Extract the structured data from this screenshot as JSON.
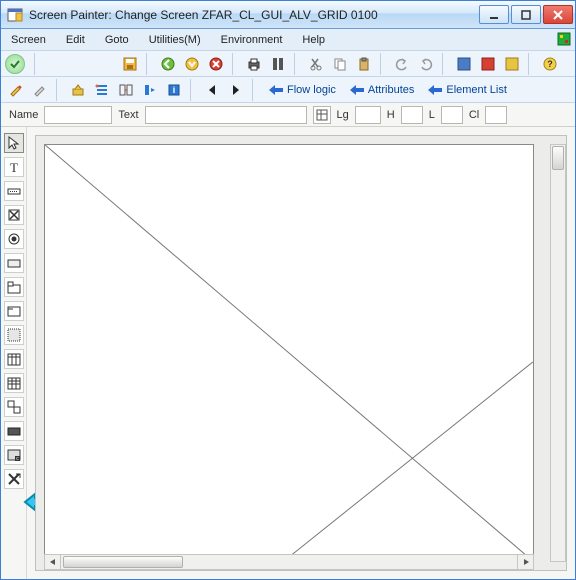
{
  "window": {
    "title": "Screen Painter:  Change Screen ZFAR_CL_GUI_ALV_GRID 0100"
  },
  "menu": {
    "screen": "Screen",
    "edit": "Edit",
    "goto": "Goto",
    "utilities": "Utilities(M)",
    "environment": "Environment",
    "help": "Help"
  },
  "toolbar2": {
    "flow_logic": "Flow logic",
    "attributes": "Attributes",
    "element_list": "Element List"
  },
  "infobar": {
    "name_label": "Name",
    "name_value": "",
    "text_label": "Text",
    "text_value": "",
    "lg_label": "Lg",
    "lg_value": "",
    "h_label": "H",
    "h_value": "",
    "l_label": "L",
    "l_value": "",
    "cl_label": "Cl",
    "cl_value": ""
  }
}
